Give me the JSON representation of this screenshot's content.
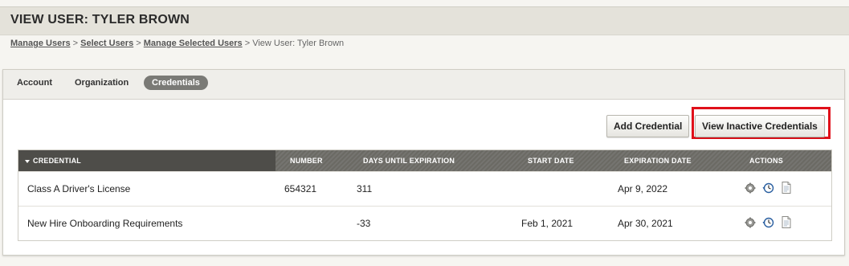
{
  "page": {
    "title": "VIEW USER: TYLER BROWN"
  },
  "breadcrumb": {
    "items": [
      "Manage Users",
      "Select Users",
      "Manage Selected Users"
    ],
    "current": "View User: Tyler Brown",
    "separator": ">"
  },
  "tabs": [
    "Account",
    "Organization",
    "Credentials"
  ],
  "active_tab": "Credentials",
  "buttons": {
    "add_credential": "Add Credential",
    "view_inactive": "View Inactive Credentials"
  },
  "table": {
    "columns": [
      "CREDENTIAL",
      "NUMBER",
      "DAYS UNTIL EXPIRATION",
      "START DATE",
      "EXPIRATION DATE",
      "ACTIONS"
    ],
    "rows": [
      {
        "credential": "Class A Driver's License",
        "number": "654321",
        "days": "311",
        "start": "",
        "expiration": "Apr 9, 2022"
      },
      {
        "credential": "New Hire Onboarding Requirements",
        "number": "",
        "days": "-33",
        "start": "Feb 1, 2021",
        "expiration": "Apr 30, 2021"
      }
    ],
    "row_actions": [
      "settings-icon",
      "history-icon",
      "document-icon"
    ]
  },
  "colors": {
    "highlight": "#e0101a",
    "header_bg": "#6b6a64",
    "active_tab": "#7a7a76"
  }
}
